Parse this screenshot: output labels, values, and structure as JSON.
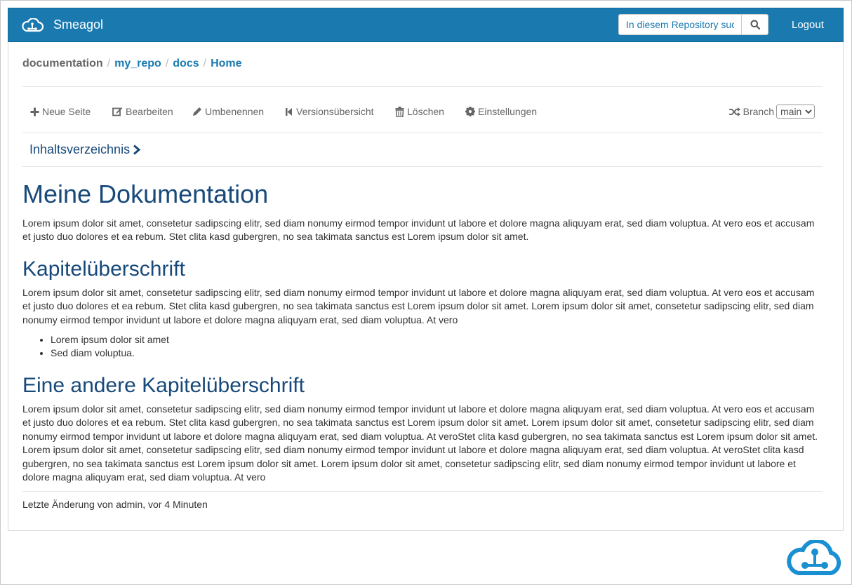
{
  "navbar": {
    "brand": "Smeagol",
    "search_placeholder": "In diesem Repository suchen",
    "logout": "Logout"
  },
  "breadcrumb": [
    "documentation",
    "my_repo",
    "docs",
    "Home"
  ],
  "toolbar": {
    "new_page": "Neue Seite",
    "edit": "Bearbeiten",
    "rename": "Umbenennen",
    "history": "Versionsübersicht",
    "delete": "Löschen",
    "settings": "Einstellungen",
    "branch_label": "Branch",
    "branch_value": "main"
  },
  "toc_label": "Inhaltsverzeichnis",
  "doc": {
    "title": "Meine Dokumentation",
    "intro": "Lorem ipsum dolor sit amet, consetetur sadipscing elitr, sed diam nonumy eirmod tempor invidunt ut labore et dolore magna aliquyam erat, sed diam voluptua. At vero eos et accusam et justo duo dolores et ea rebum. Stet clita kasd gubergren, no sea takimata sanctus est Lorem ipsum dolor sit amet.",
    "section1_title": "Kapitelüberschrift",
    "section1_text": "Lorem ipsum dolor sit amet, consetetur sadipscing elitr, sed diam nonumy eirmod tempor invidunt ut labore et dolore magna aliquyam erat, sed diam voluptua. At vero eos et accusam et justo duo dolores et ea rebum. Stet clita kasd gubergren, no sea takimata sanctus est Lorem ipsum dolor sit amet. Lorem ipsum dolor sit amet, consetetur sadipscing elitr, sed diam nonumy eirmod tempor invidunt ut labore et dolore magna aliquyam erat, sed diam voluptua. At vero",
    "bullets": [
      "Lorem ipsum dolor sit amet",
      "Sed diam voluptua."
    ],
    "section2_title": "Eine andere Kapitelüberschrift",
    "section2_text": "Lorem ipsum dolor sit amet, consetetur sadipscing elitr, sed diam nonumy eirmod tempor invidunt ut labore et dolore magna aliquyam erat, sed diam voluptua. At vero eos et accusam et justo duo dolores et ea rebum. Stet clita kasd gubergren, no sea takimata sanctus est Lorem ipsum dolor sit amet. Lorem ipsum dolor sit amet, consetetur sadipscing elitr, sed diam nonumy eirmod tempor invidunt ut labore et dolore magna aliquyam erat, sed diam voluptua. At veroStet clita kasd gubergren, no sea takimata sanctus est Lorem ipsum dolor sit amet. Lorem ipsum dolor sit amet, consetetur sadipscing elitr, sed diam nonumy eirmod tempor invidunt ut labore et dolore magna aliquyam erat, sed diam voluptua. At veroStet clita kasd gubergren, no sea takimata sanctus est Lorem ipsum dolor sit amet. Lorem ipsum dolor sit amet, consetetur sadipscing elitr, sed diam nonumy eirmod tempor invidunt ut labore et dolore magna aliquyam erat, sed diam voluptua. At vero"
  },
  "last_change": "Letzte Änderung von admin, vor 4 Minuten",
  "colors": {
    "navbar": "#1a7ab0",
    "heading": "#17497a",
    "link": "#1a7ab0"
  },
  "icons": [
    "cloud-logo-icon",
    "search-icon",
    "plus-icon",
    "edit-icon",
    "pencil-icon",
    "history-icon",
    "trash-icon",
    "gear-icon",
    "shuffle-icon",
    "chevron-right-icon"
  ]
}
